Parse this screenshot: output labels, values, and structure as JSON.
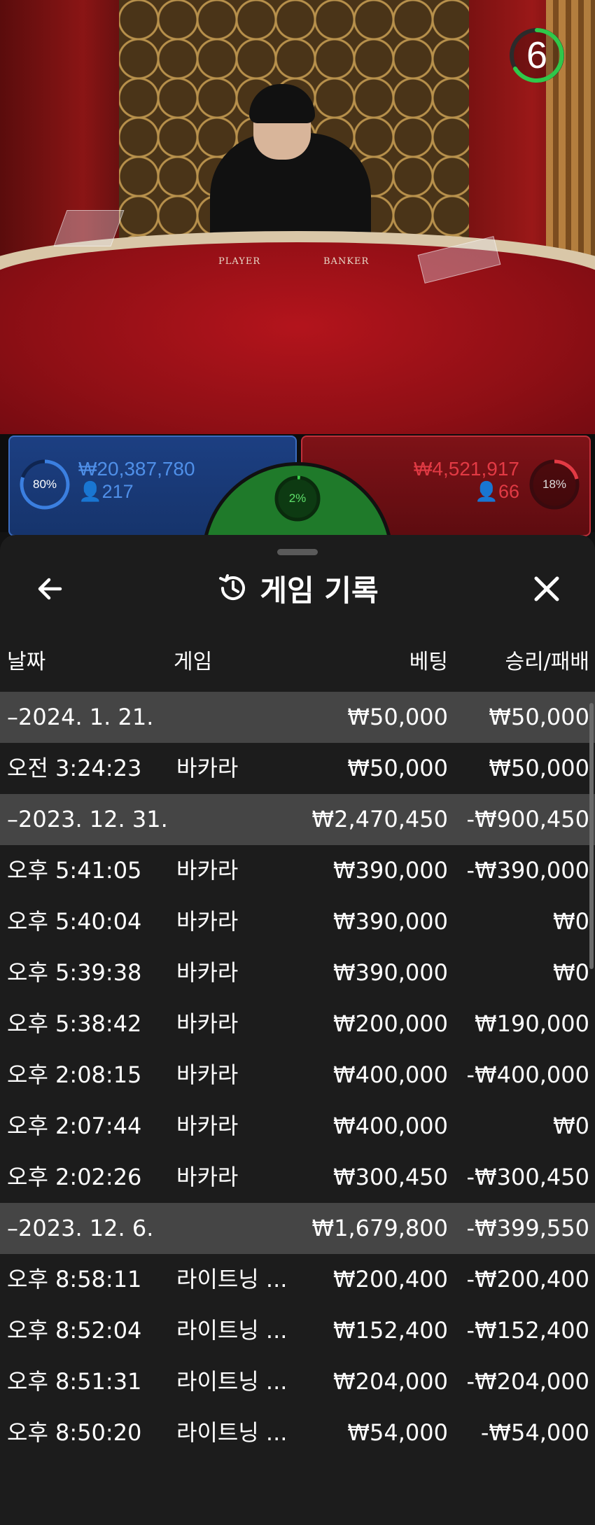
{
  "video": {
    "countdown": "6",
    "felt_player_label": "PLAYER",
    "felt_banker_label": "BANKER"
  },
  "betting": {
    "player": {
      "percent": "80%",
      "percent_value": 0.8,
      "amount": "₩20,387,780",
      "count": "217",
      "color": "#3b7fe0"
    },
    "banker": {
      "percent": "18%",
      "percent_value": 0.18,
      "amount": "₩4,521,917",
      "count": "66",
      "color": "#e23a44"
    },
    "tie": {
      "percent": "2%",
      "percent_value": 0.02,
      "color": "#3ad04a"
    }
  },
  "history": {
    "title": "게임 기록",
    "icons": {
      "back": "arrow-left-icon",
      "title": "history-icon",
      "close": "close-icon"
    },
    "columns": {
      "date": "날짜",
      "game": "게임",
      "bet": "베팅",
      "winloss": "승리/패배"
    },
    "rows": [
      {
        "type": "group",
        "date": "–2024. 1. 21.",
        "game": "",
        "bet": "₩50,000",
        "winloss": "₩50,000"
      },
      {
        "type": "item",
        "date": "오전 3:24:23",
        "game": "바카라",
        "bet": "₩50,000",
        "winloss": "₩50,000"
      },
      {
        "type": "group",
        "date": "–2023. 12. 31.",
        "game": "",
        "bet": "₩2,470,450",
        "winloss": "-₩900,450"
      },
      {
        "type": "item",
        "date": "오후 5:41:05",
        "game": "바카라",
        "bet": "₩390,000",
        "winloss": "-₩390,000"
      },
      {
        "type": "item",
        "date": "오후 5:40:04",
        "game": "바카라",
        "bet": "₩390,000",
        "winloss": "₩0"
      },
      {
        "type": "item",
        "date": "오후 5:39:38",
        "game": "바카라",
        "bet": "₩390,000",
        "winloss": "₩0"
      },
      {
        "type": "item",
        "date": "오후 5:38:42",
        "game": "바카라",
        "bet": "₩200,000",
        "winloss": "₩190,000"
      },
      {
        "type": "item",
        "date": "오후 2:08:15",
        "game": "바카라",
        "bet": "₩400,000",
        "winloss": "-₩400,000"
      },
      {
        "type": "item",
        "date": "오후 2:07:44",
        "game": "바카라",
        "bet": "₩400,000",
        "winloss": "₩0"
      },
      {
        "type": "item",
        "date": "오후 2:02:26",
        "game": "바카라",
        "bet": "₩300,450",
        "winloss": "-₩300,450"
      },
      {
        "type": "group",
        "date": "–2023. 12. 6.",
        "game": "",
        "bet": "₩1,679,800",
        "winloss": "-₩399,550"
      },
      {
        "type": "item",
        "date": "오후 8:58:11",
        "game": "라이트닝 ...",
        "bet": "₩200,400",
        "winloss": "-₩200,400"
      },
      {
        "type": "item",
        "date": "오후 8:52:04",
        "game": "라이트닝 ...",
        "bet": "₩152,400",
        "winloss": "-₩152,400"
      },
      {
        "type": "item",
        "date": "오후 8:51:31",
        "game": "라이트닝 ...",
        "bet": "₩204,000",
        "winloss": "-₩204,000"
      },
      {
        "type": "item",
        "date": "오후 8:50:20",
        "game": "라이트닝 ...",
        "bet": "₩54,000",
        "winloss": "-₩54,000"
      }
    ]
  }
}
